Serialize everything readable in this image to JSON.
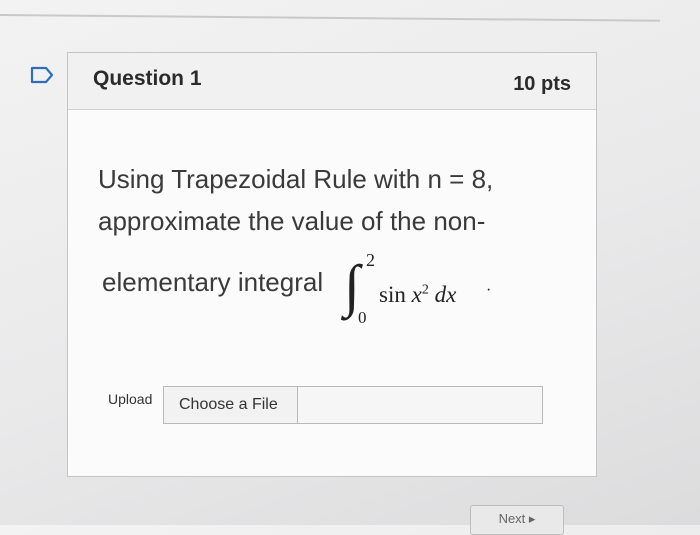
{
  "question": {
    "title": "Question 1",
    "points": "10 pts",
    "text_lines": [
      "Using Trapezoidal Rule with n = 8,",
      "approximate the value of the non-",
      "elementary integral"
    ],
    "integral": {
      "upper_limit": "2",
      "lower_limit": "0",
      "function": "sin",
      "variable": "x",
      "exponent": "2",
      "differential": "dx",
      "trailing": "·"
    }
  },
  "upload": {
    "label": "Upload",
    "button": "Choose a File"
  },
  "navigation": {
    "next_label": "Next ▸"
  },
  "colors": {
    "card_bg": "#fbfbfb",
    "header_bg": "#f1f1f2",
    "text": "#3a3a3a"
  }
}
